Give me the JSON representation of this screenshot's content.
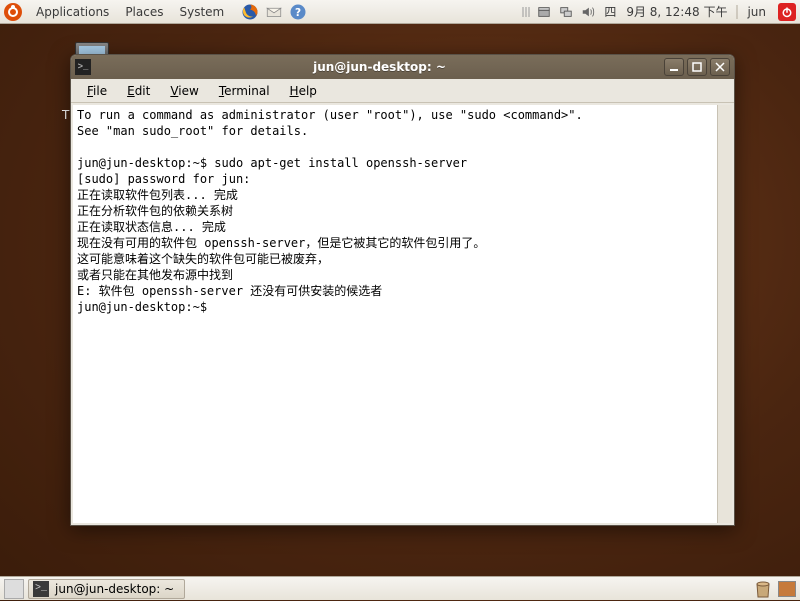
{
  "top_panel": {
    "menus": {
      "apps": "Applications",
      "places": "Places",
      "system": "System"
    },
    "tray": {
      "day": "四",
      "date": "9月  8, 12:48 下午",
      "user": "jun"
    }
  },
  "desktop": {
    "icon_t_letter": "T"
  },
  "terminal": {
    "title": "jun@jun-desktop: ~",
    "menubar": {
      "file": "File",
      "edit": "Edit",
      "view": "View",
      "terminal": "Terminal",
      "help": "Help"
    },
    "lines": {
      "l0": "To run a command as administrator (user \"root\"), use \"sudo <command>\".",
      "l1": "See \"man sudo_root\" for details.",
      "l2": "",
      "l3": "jun@jun-desktop:~$ sudo apt-get install openssh-server",
      "l4": "[sudo] password for jun: ",
      "l5": "正在读取软件包列表... 完成",
      "l6": "正在分析软件包的依赖关系树       ",
      "l7": "正在读取状态信息... 完成       ",
      "l8": "现在没有可用的软件包 openssh-server，但是它被其它的软件包引用了。",
      "l9": "这可能意味着这个缺失的软件包可能已被废弃，",
      "l10": "或者只能在其他发布源中找到",
      "l11": "E: 软件包 openssh-server 还没有可供安装的候选者",
      "l12": "jun@jun-desktop:~$ "
    }
  },
  "taskbar": {
    "title": "jun@jun-desktop: ~"
  }
}
